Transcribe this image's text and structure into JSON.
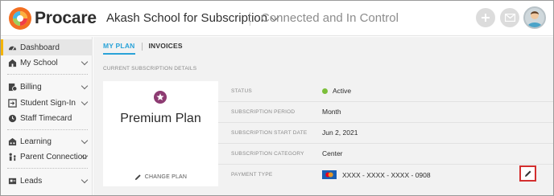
{
  "header": {
    "logo_text": "Procare",
    "school_name": "Akash School for Subscription",
    "tagline": "Connected and In Control",
    "icons": [
      "plus-icon",
      "mail-icon",
      "avatar"
    ]
  },
  "sidebar": {
    "items": [
      {
        "label": "Dashboard",
        "icon": "dashboard-icon",
        "active": true,
        "chevron": false
      },
      {
        "label": "My School",
        "icon": "school-icon",
        "active": false,
        "chevron": true
      },
      {
        "label": "Billing",
        "icon": "billing-icon",
        "active": false,
        "chevron": true
      },
      {
        "label": "Student Sign-In",
        "icon": "sign-in-icon",
        "active": false,
        "chevron": true
      },
      {
        "label": "Staff Timecard",
        "icon": "timecard-icon",
        "active": false,
        "chevron": false
      },
      {
        "label": "Learning",
        "icon": "learning-icon",
        "active": false,
        "chevron": true
      },
      {
        "label": "Parent Connection",
        "icon": "parent-icon",
        "active": false,
        "chevron": true
      },
      {
        "label": "Leads",
        "icon": "leads-icon",
        "active": false,
        "chevron": true
      }
    ]
  },
  "main": {
    "tabs": [
      {
        "label": "MY PLAN",
        "active": true
      },
      {
        "label": "INVOICES",
        "active": false
      }
    ],
    "section_title": "CURRENT SUBSCRIPTION DETAILS",
    "plan": {
      "name": "Premium Plan",
      "change_label": "CHANGE PLAN"
    },
    "details": [
      {
        "key": "STATUS",
        "value": "Active"
      },
      {
        "key": "SUBSCRIPTION PERIOD",
        "value": "Month"
      },
      {
        "key": "SUBSCRIPTION START DATE",
        "value": "Jun 2, 2021"
      },
      {
        "key": "SUBSCRIPTION CATEGORY",
        "value": "Center"
      },
      {
        "key": "PAYMENT TYPE",
        "value": "XXXX - XXXX - XXXX - 0908"
      }
    ]
  },
  "colors": {
    "accent": "#2aa3d8",
    "sidebar_active": "#f4b400",
    "status_active": "#7cbf3a",
    "plan_icon": "#8d3b72",
    "highlight": "#d32f2f"
  }
}
